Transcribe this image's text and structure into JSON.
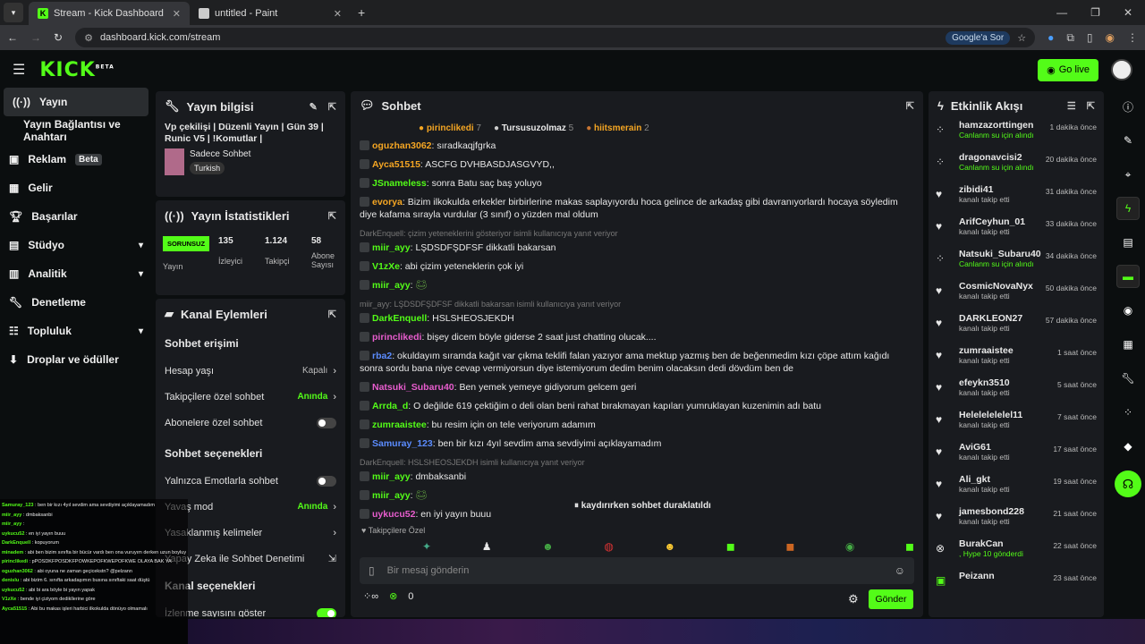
{
  "browser": {
    "tabs": [
      {
        "label": "Stream - Kick Dashboard",
        "active": true
      },
      {
        "label": "untitled - Paint",
        "active": false
      }
    ],
    "url": "dashboard.kick.com/stream",
    "google_pill": "Google'a Sor"
  },
  "topbar": {
    "logo": "KICK",
    "logo_beta": "BETA",
    "golive_label": "Go live"
  },
  "sidebar": {
    "items": [
      {
        "label": "Yayın",
        "icon": "broadcast-icon"
      },
      {
        "label": "Yayın Bağlantısı ve Anahtarı"
      },
      {
        "label": "Reklam",
        "badge": "Beta"
      },
      {
        "label": "Gelir"
      },
      {
        "label": "Başarılar"
      },
      {
        "label": "Stüdyo"
      },
      {
        "label": "Analitik"
      },
      {
        "label": "Denetleme"
      },
      {
        "label": "Topluluk"
      },
      {
        "label": "Droplar ve ödüller"
      }
    ]
  },
  "stream_info": {
    "title": "Yayın bilgisi",
    "stream_title": "Vp çekilişi | Düzenli Yayın | Gün 39 | Runic V5 | !Komutlar |",
    "category": "Sadece Sohbet",
    "tag": "Turkish"
  },
  "stats": {
    "title": "Yayın İstatistikleri",
    "status": "SORUNSUZ",
    "status_label": "Yayın",
    "viewers": "135",
    "viewers_label": "İzleyici",
    "followers": "1.124",
    "followers_label": "Takipçi",
    "subs": "58",
    "subs_label": "Abone Sayısı"
  },
  "channel_actions": {
    "title": "Kanal Eylemleri",
    "section1": "Sohbet erişimi",
    "rows1": [
      {
        "label": "Hesap yaşı",
        "value": "Kapalı"
      },
      {
        "label": "Takipçilere özel sohbet",
        "value": "Anında"
      },
      {
        "label": "Abonelere özel sohbet",
        "value": ""
      }
    ],
    "section2": "Sohbet seçenekleri",
    "rows2": [
      {
        "label": "Yalnızca Emotlarla sohbet",
        "value": ""
      },
      {
        "label": "Yavaş mod",
        "value": "Anında"
      },
      {
        "label": "Yasaklanmış kelimeler",
        "value": ""
      },
      {
        "label": "Yapay Zeka ile Sohbet Denetimi",
        "value": ""
      }
    ],
    "section3": "Kanal seçenekleri",
    "row3": "İzlenme sayısını göster"
  },
  "chat": {
    "title": "Sohbet",
    "top_users": [
      {
        "name": "pirinclikedi",
        "count": "7"
      },
      {
        "name": "Tursusuzolmaz",
        "count": "5"
      },
      {
        "name": "hiitsmerain",
        "count": "2"
      }
    ],
    "messages": [
      {
        "user": "oguzhan3062",
        "color": "#f5a623",
        "text": "sıradkaqjfgrka"
      },
      {
        "user": "Ayca51515",
        "color": "#f5a623",
        "text": "ASCFG DVHBASDJASGVYD,,"
      },
      {
        "user": "JSnameless",
        "color": "#53fc18",
        "text": "sonra Batu saç baş yoluyo"
      },
      {
        "user": "evorya",
        "color": "#f5a623",
        "text": "Bizim ilkokulda erkekler birbirlerine makas saplayıyordu hoca gelince de arkadaş gibi davranıyorlardı hocaya söyledim diye kafama sırayla vurdular (3 sınıf) o yüzden mal oldum"
      },
      {
        "reply": "DarkEnquell: çizim yeteneklerini gösteriyor isimli kullanıcıya yanıt veriyor",
        "user": "miir_ayy",
        "color": "#53fc18",
        "text": "LŞDSDFŞDFSF dikkatli bakarsan"
      },
      {
        "user": "V1zXe",
        "color": "#53fc18",
        "text": "abi çizim yeteneklerin çok iyi"
      },
      {
        "user": "miir_ayy",
        "color": "#53fc18",
        "text": ""
      },
      {
        "reply": "miir_ayy: LŞDSDFŞDFSF dikkatli bakarsan isimli kullanıcıya yanıt veriyor",
        "user": "DarkEnquell",
        "color": "#53fc18",
        "text": "HSLSHEOSJEKDH"
      },
      {
        "user": "pirinclikedi",
        "color": "#e85dce",
        "text": "bişey dicem böyle giderse 2 saat just chatting olucak...."
      },
      {
        "user": "rba2",
        "color": "#5b8cff",
        "text": "okuldayım sıramda kağıt var çıkma teklifi falan yazıyor ama mektup yazmış ben de beğenmedim kızı çöpe attım kağıdı sonra sordu bana niye cevap vermiyorsun diye istemiyorum dedim benim olacaksın dedi dövdüm ben de"
      },
      {
        "user": "Natsuki_Subaru40",
        "color": "#e85dce",
        "text": "Ben yemek yemeye gidiyorum gelcem geri"
      },
      {
        "user": "Arrda_d",
        "color": "#53fc18",
        "text": "O değilde 619 çektiğim o deli olan beni rahat bırakmayan kapıları yumruklayan kuzenimin adı batu"
      },
      {
        "user": "zumraaistee",
        "color": "#53fc18",
        "text": "bu resim için on tele veriyorum adamım"
      },
      {
        "user": "Samuray_123",
        "color": "#5b8cff",
        "text": "ben bir kızı 4yıl sevdim ama sevdiyimi açıklayamadım"
      },
      {
        "reply": "DarkEnquell: HSLSHEOSJEKDH isimli kullanıcıya yanıt veriyor",
        "user": "miir_ayy",
        "color": "#53fc18",
        "text": "dmbaksanbi"
      },
      {
        "user": "miir_ayy",
        "color": "#53fc18",
        "text": ""
      },
      {
        "user": "uykucu52",
        "color": "#e85dce",
        "text": "en iyi yayın buuu"
      }
    ],
    "paused": "kaydırırken sohbet duraklatıldı",
    "followers_only": "Takipçilere Özel",
    "input_placeholder": "Bir mesaj gönderin",
    "points": "0",
    "send": "Gönder"
  },
  "activity": {
    "title": "Etkinlik Akışı",
    "events": [
      {
        "user": "hamzazorttingen",
        "sub": "Canlanm su için alındı",
        "time": "1 dakika önce",
        "icon": "drop-icon"
      },
      {
        "user": "dragonavcisi2",
        "sub": "Canlanm su için alındı",
        "time": "20 dakika önce",
        "icon": "drop-icon"
      },
      {
        "user": "zibidi41",
        "sub": "kanalı takip etti",
        "time": "31 dakika önce",
        "icon": "heart-icon"
      },
      {
        "user": "ArifCeyhun_01",
        "sub": "kanalı takip etti",
        "time": "33 dakika önce",
        "icon": "heart-icon"
      },
      {
        "user": "Natsuki_Subaru40",
        "sub": "Canlanm su için alındı",
        "time": "34 dakika önce",
        "icon": "drop-icon"
      },
      {
        "user": "CosmicNovaNyx",
        "sub": "kanalı takip etti",
        "time": "50 dakika önce",
        "icon": "heart-icon"
      },
      {
        "user": "DARKLEON27",
        "sub": "kanalı takip etti",
        "time": "57 dakika önce",
        "icon": "heart-icon"
      },
      {
        "user": "zumraaistee",
        "sub": "kanalı takip etti",
        "time": "1 saat önce",
        "icon": "heart-icon"
      },
      {
        "user": "efeykn3510",
        "sub": "kanalı takip etti",
        "time": "5 saat önce",
        "icon": "heart-icon"
      },
      {
        "user": "Helelelelelel11",
        "sub": "kanalı takip etti",
        "time": "7 saat önce",
        "icon": "heart-icon"
      },
      {
        "user": "AviG61",
        "sub": "kanalı takip etti",
        "time": "17 saat önce",
        "icon": "heart-icon"
      },
      {
        "user": "Ali_gkt",
        "sub": "kanalı takip etti",
        "time": "19 saat önce",
        "icon": "heart-icon"
      },
      {
        "user": "jamesbond228",
        "sub": "kanalı takip etti",
        "time": "21 saat önce",
        "icon": "heart-icon"
      },
      {
        "user": "BurakCan",
        "sub": ", Hype 10 gönderdi",
        "time": "22 saat önce",
        "icon": "kick-icon"
      },
      {
        "user": "Peizann",
        "sub": "",
        "time": "23 saat önce",
        "icon": "gift-icon"
      }
    ]
  },
  "overlay_chat": [
    {
      "u": "Samuray_123",
      "t": "ben bir kızı 4yıl sevdim ama sevdiyimi açıklayamadım"
    },
    {
      "u": "miir_ayy",
      "t": "dmbaksanbi"
    },
    {
      "u": "miir_ayy",
      "t": ""
    },
    {
      "u": "uykucu52",
      "t": "en iyi yayın buuu"
    },
    {
      "u": "DarkEnquell",
      "t": "kopuyorum"
    },
    {
      "u": "minadem",
      "t": "abi ben bizim sınıfta bir bücür vardı ben ona vuruyım derken uzun boyluya tokat atım yanlışlıkla"
    },
    {
      "u": "pirinclikedi",
      "t": "pPOSDKFPOSDKFPOWKEPOFKWEPOFKWE OLAYA BAK YA"
    },
    {
      "u": "oguzhan3062",
      "t": "abi oyuna ne zaman geçicekstn? @pelzann"
    },
    {
      "u": "denislu",
      "t": "abi bizim 6. sınıfta arkadaşımın busına sınıftaki saat düştü"
    },
    {
      "u": "uykucu52",
      "t": "abi bi ara böyle bi yayın yapak"
    },
    {
      "u": "V1zXe",
      "t": "bende iyi çiziyom dedikllerine göre"
    },
    {
      "u": "Ayca51515",
      "t": "Abi bu makas işleri harbici ilkokulda dönüyo olmamalı"
    }
  ]
}
